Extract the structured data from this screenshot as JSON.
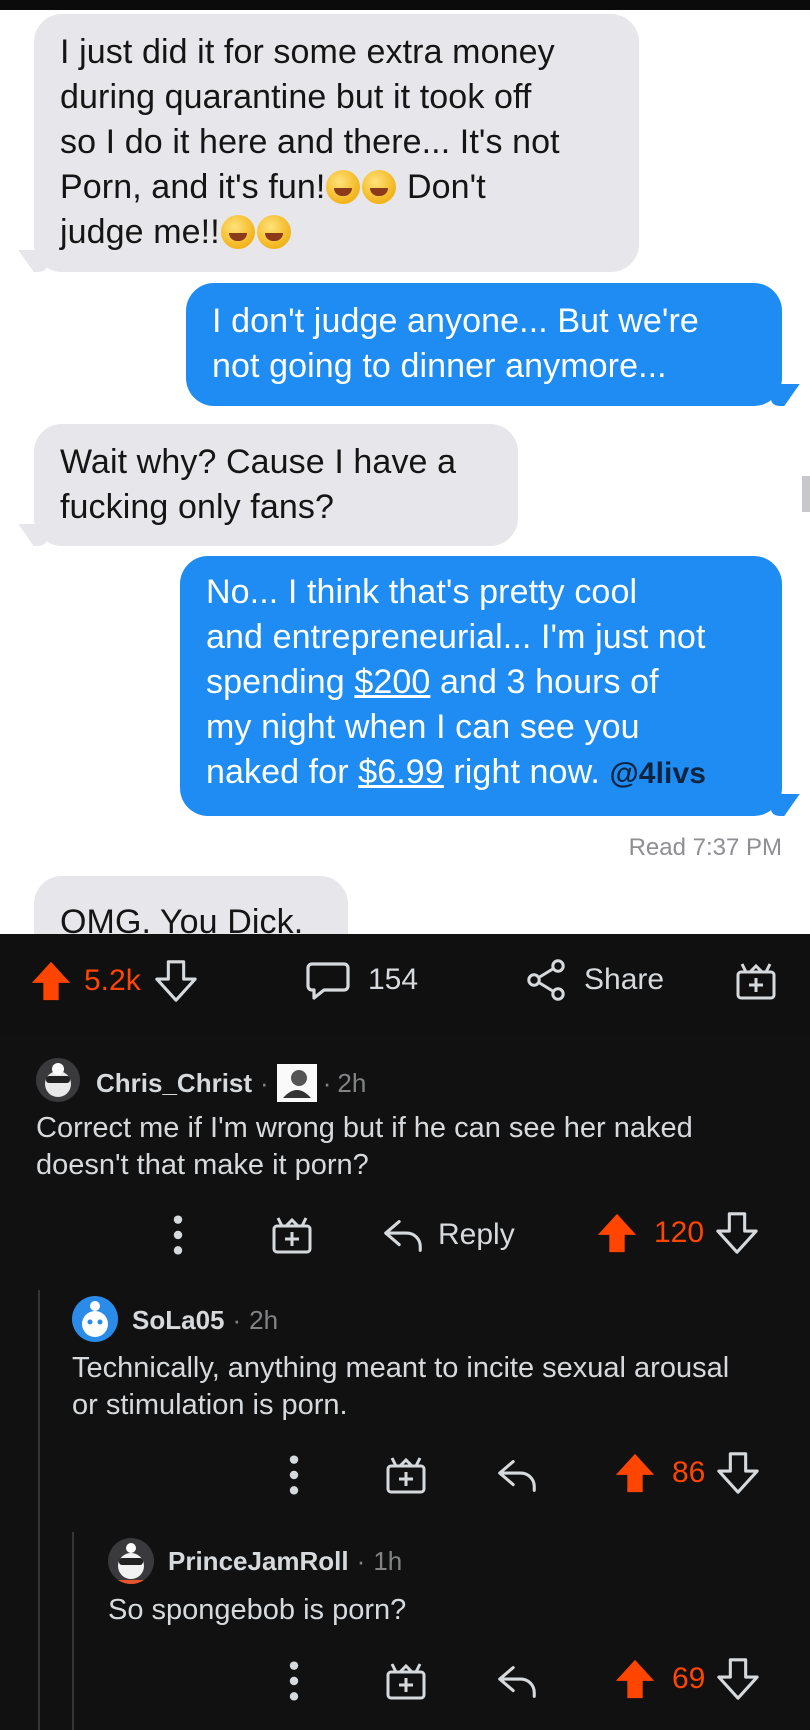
{
  "messages": {
    "m1": {
      "line1": "I just did it for some extra money",
      "line2": "during quarantine but it took off",
      "line3": "so I do it here and there... It's not",
      "line4_a": "Porn, and it's fun!",
      "line4_b": " Don't",
      "line5": "judge me!!"
    },
    "m2": {
      "line1": "I don't judge anyone... But we're",
      "line2": "not going to dinner anymore..."
    },
    "m3": {
      "line1": "Wait why? Cause I have a",
      "line2": "fucking only fans?"
    },
    "m4": {
      "line1": "No... I think that's pretty cool",
      "line2": "and entrepreneurial... I'm just not",
      "line3_a": "spending ",
      "line3_u": "$200",
      "line3_b": " and 3 hours of",
      "line4": "my night when I can see you",
      "line5_a": "naked for ",
      "line5_u": "$6.99",
      "line5_b": " right now. ",
      "watermark": "@4livs"
    },
    "read_receipt": "Read 7:37 PM",
    "m5": {
      "line1": "OMG. You Dick."
    }
  },
  "post_actions": {
    "upvotes": "5.2k",
    "comments": "154",
    "share": "Share"
  },
  "comments": [
    {
      "author": "Chris_Christ",
      "sep1": "·",
      "sep2": "·",
      "time": "2h",
      "text_line1": "Correct me if I'm wrong but if he can see her naked",
      "text_line2": "doesn't that make it porn?",
      "reply": "Reply",
      "score": "120"
    },
    {
      "author": "SoLa05",
      "sep": "·",
      "time": "2h",
      "text_line1": "Technically, anything meant to incite sexual arousal",
      "text_line2": "or stimulation is porn.",
      "score": "86"
    },
    {
      "author": "PrinceJamRoll",
      "sep": "·",
      "time": "1h",
      "text_line1": "So spongebob is porn?",
      "score": "69"
    }
  ],
  "colors": {
    "upvote": "#ff4500",
    "imessage_blue": "#1f8cf3",
    "incoming_gray": "#e6e6eb",
    "dark_bg": "#111112",
    "text_light": "#d7dadc"
  },
  "icons": [
    "upvote-arrow-icon",
    "downvote-arrow-icon",
    "comment-bubble-icon",
    "share-icon",
    "award-gift-icon",
    "more-dots-icon",
    "reply-arrow-icon"
  ]
}
